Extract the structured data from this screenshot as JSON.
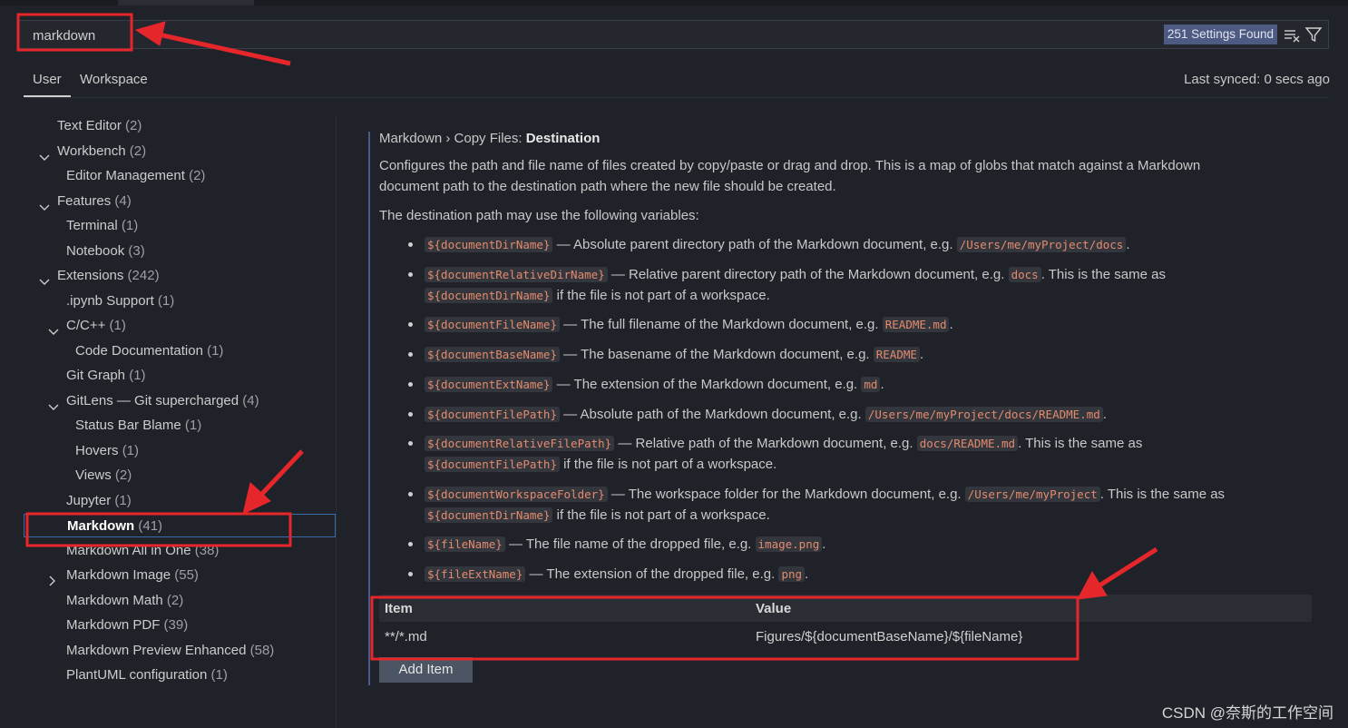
{
  "search": {
    "value": "markdown",
    "result_count": "251 Settings Found"
  },
  "tabs": {
    "user": "User",
    "workspace": "Workspace"
  },
  "last_synced": "Last synced: 0 secs ago",
  "toc": [
    {
      "label": "Text Editor",
      "count": "(2)"
    },
    {
      "label": "Workbench",
      "count": "(2)"
    },
    {
      "label": "Editor Management",
      "count": "(2)"
    },
    {
      "label": "Features",
      "count": "(4)"
    },
    {
      "label": "Terminal",
      "count": "(1)"
    },
    {
      "label": "Notebook",
      "count": "(3)"
    },
    {
      "label": "Extensions",
      "count": "(242)"
    },
    {
      "label": ".ipynb Support",
      "count": "(1)"
    },
    {
      "label": "C/C++",
      "count": "(1)"
    },
    {
      "label": "Code Documentation",
      "count": "(1)"
    },
    {
      "label": "Git Graph",
      "count": "(1)"
    },
    {
      "label": "GitLens — Git supercharged",
      "count": "(4)"
    },
    {
      "label": "Status Bar Blame",
      "count": "(1)"
    },
    {
      "label": "Hovers",
      "count": "(1)"
    },
    {
      "label": "Views",
      "count": "(2)"
    },
    {
      "label": "Jupyter",
      "count": "(1)"
    },
    {
      "label": "Markdown",
      "count": "(41)"
    },
    {
      "label": "Markdown All in One",
      "count": "(38)"
    },
    {
      "label": "Markdown Image",
      "count": "(55)"
    },
    {
      "label": "Markdown Math",
      "count": "(2)"
    },
    {
      "label": "Markdown PDF",
      "count": "(39)"
    },
    {
      "label": "Markdown Preview Enhanced",
      "count": "(58)"
    },
    {
      "label": "PlantUML configuration",
      "count": "(1)"
    }
  ],
  "setting": {
    "breadcrumb": "Markdown › Copy Files: ",
    "name": "Destination",
    "desc_line1": "Configures the path and file name of files created by copy/paste or drag and drop. This is a map of globs that match against a Markdown",
    "desc_line2": "document path to the destination path where the new file should be created.",
    "vars_intro": "The destination path may use the following variables:",
    "vars": [
      {
        "code": "${documentDirName}",
        "t1": " — Absolute parent directory path of the Markdown document, e.g. ",
        "ex": "/Users/me/myProject/docs",
        "t2": "."
      },
      {
        "code": "${documentRelativeDirName}",
        "t1": " — Relative parent directory path of the Markdown document, e.g. ",
        "ex": "docs",
        "t2": ". This is the same as",
        "code2": "${documentDirName}",
        "t3": " if the file is not part of a workspace."
      },
      {
        "code": "${documentFileName}",
        "t1": " — The full filename of the Markdown document, e.g. ",
        "ex": "README.md",
        "t2": "."
      },
      {
        "code": "${documentBaseName}",
        "t1": " — The basename of the Markdown document, e.g. ",
        "ex": "README",
        "t2": "."
      },
      {
        "code": "${documentExtName}",
        "t1": " — The extension of the Markdown document, e.g. ",
        "ex": "md",
        "t2": "."
      },
      {
        "code": "${documentFilePath}",
        "t1": " — Absolute path of the Markdown document, e.g. ",
        "ex": "/Users/me/myProject/docs/README.md",
        "t2": "."
      },
      {
        "code": "${documentRelativeFilePath}",
        "t1": " — Relative path of the Markdown document, e.g. ",
        "ex": "docs/README.md",
        "t2": ". This is the same as",
        "code2": "${documentFilePath}",
        "t3": " if the file is not part of a workspace."
      },
      {
        "code": "${documentWorkspaceFolder}",
        "t1": " — The workspace folder for the Markdown document, e.g. ",
        "ex": "/Users/me/myProject",
        "t2": ". This is the same as",
        "code2": "${documentDirName}",
        "t3": " if the file is not part of a workspace."
      },
      {
        "code": "${fileName}",
        "t1": " — The file name of the dropped file, e.g. ",
        "ex": "image.png",
        "t2": "."
      },
      {
        "code": "${fileExtName}",
        "t1": " — The extension of the dropped file, e.g. ",
        "ex": "png",
        "t2": "."
      }
    ],
    "table": {
      "item_header": "Item",
      "value_header": "Value",
      "row_item": "**/*.md",
      "row_value": "Figures/${documentBaseName}/${fileName}"
    },
    "add_item": "Add Item"
  },
  "watermark": "CSDN @奈斯的工作空间",
  "colors": {
    "annotation": "#e5262b",
    "selection_border": "#3a6aa8",
    "badge": "#4d5a82"
  },
  "icons": [
    "clear-filter-icon",
    "filter-icon",
    "chevron-down-icon",
    "chevron-right-icon"
  ]
}
